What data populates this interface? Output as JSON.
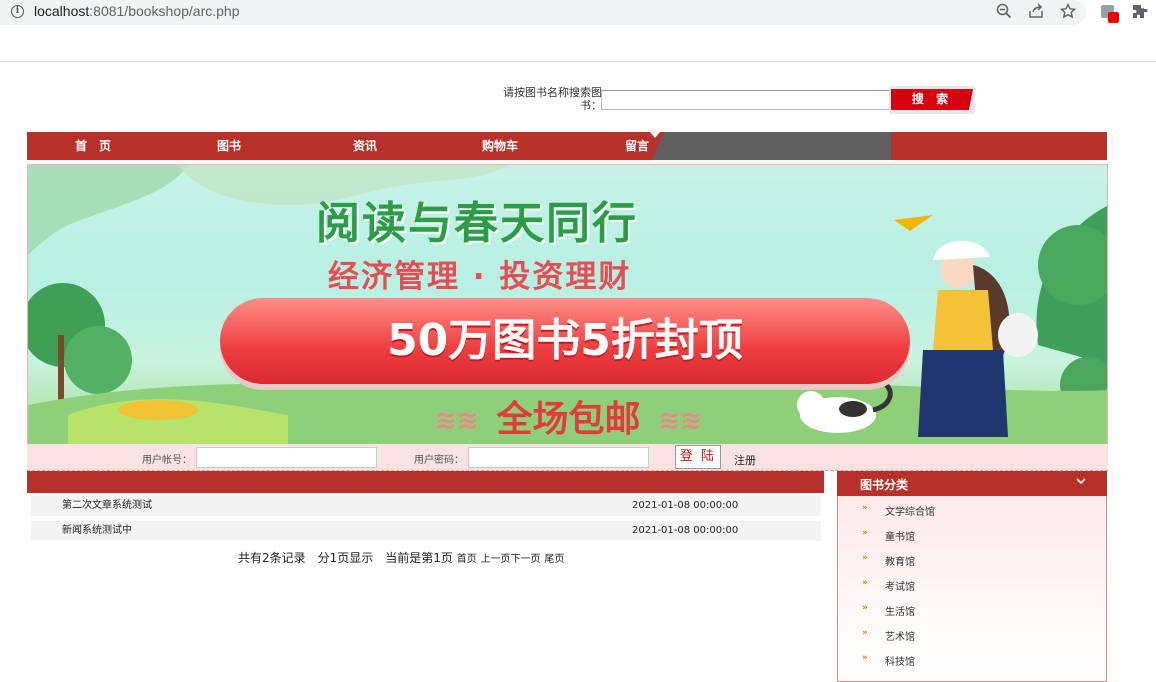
{
  "browser": {
    "url_host": "localhost",
    "url_rest": ":8081/bookshop/arc.php"
  },
  "search": {
    "label": "请按图书名称搜索图书：",
    "button": "搜 索",
    "value": ""
  },
  "nav": {
    "items": [
      "首　页",
      "图书",
      "资讯",
      "购物车",
      "留言"
    ]
  },
  "banner": {
    "title": "阅读与春天同行",
    "subtitle": "经济管理 · 投资理财",
    "highlight": "50万图书5折封顶",
    "bottom": "全场包邮",
    "colors": {
      "title": "#2c9c47",
      "accent": "#e53a3c"
    }
  },
  "login": {
    "user_label": "用户帐号：",
    "pass_label": "用户密码：",
    "button": "登 陆",
    "register": "注册"
  },
  "articles": {
    "rows": [
      {
        "title": "第二次文章系统测试",
        "date": "2021-01-08 00:00:00"
      },
      {
        "title": "新闻系统测试中",
        "date": "2021-01-08 00:00:00"
      }
    ],
    "pager": {
      "summary": "共有2条记录　分1页显示　当前是第1页",
      "first": "首页",
      "prev": "上一页",
      "next": "下一页",
      "last": "尾页"
    }
  },
  "sidebar": {
    "title": "图书分类",
    "categories": [
      "文学综合馆",
      "童书馆",
      "教育馆",
      "考试馆",
      "生活馆",
      "艺术馆",
      "科技馆"
    ]
  },
  "theme": {
    "primary": "#b8302a",
    "nav_active": "#5f5f5f"
  }
}
